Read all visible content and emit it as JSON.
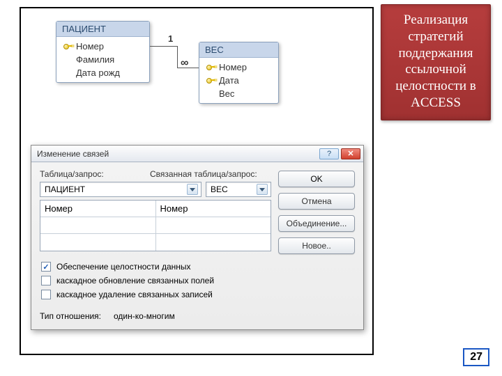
{
  "caption": "Реализация стратегий поддержания ссылочной целостности в ACCESS",
  "page_number": "27",
  "diagram": {
    "table1": {
      "name": "ПАЦИЕНТ",
      "fields": [
        {
          "label": "Номер",
          "key": true
        },
        {
          "label": "Фамилия",
          "key": false
        },
        {
          "label": "Дата рожд",
          "key": false
        }
      ]
    },
    "table2": {
      "name": "ВЕС",
      "fields": [
        {
          "label": "Номер",
          "key": true
        },
        {
          "label": "Дата",
          "key": true
        },
        {
          "label": "Вес",
          "key": false
        }
      ]
    },
    "rel": {
      "left_card": "1",
      "right_card": "∞"
    }
  },
  "dialog": {
    "title": "Изменение связей",
    "labels": {
      "table": "Таблица/запрос:",
      "related": "Связанная таблица/запрос:"
    },
    "combo1": "ПАЦИЕНТ",
    "combo2": "ВЕС",
    "fields": {
      "left1": "Номер",
      "right1": "Номер",
      "left2": "",
      "right2": "",
      "left3": "",
      "right3": ""
    },
    "checks": {
      "integrity": {
        "label": "Обеспечение целостности данных",
        "checked": true
      },
      "cascade_update": {
        "label": "каскадное обновление связанных полей",
        "checked": false
      },
      "cascade_delete": {
        "label": "каскадное удаление связанных записей",
        "checked": false
      }
    },
    "rel_type_label": "Тип отношения:",
    "rel_type_value": "один-ко-многим",
    "buttons": {
      "ok": "OK",
      "cancel": "Отмена",
      "join": "Объединение...",
      "new": "Новое.."
    }
  }
}
